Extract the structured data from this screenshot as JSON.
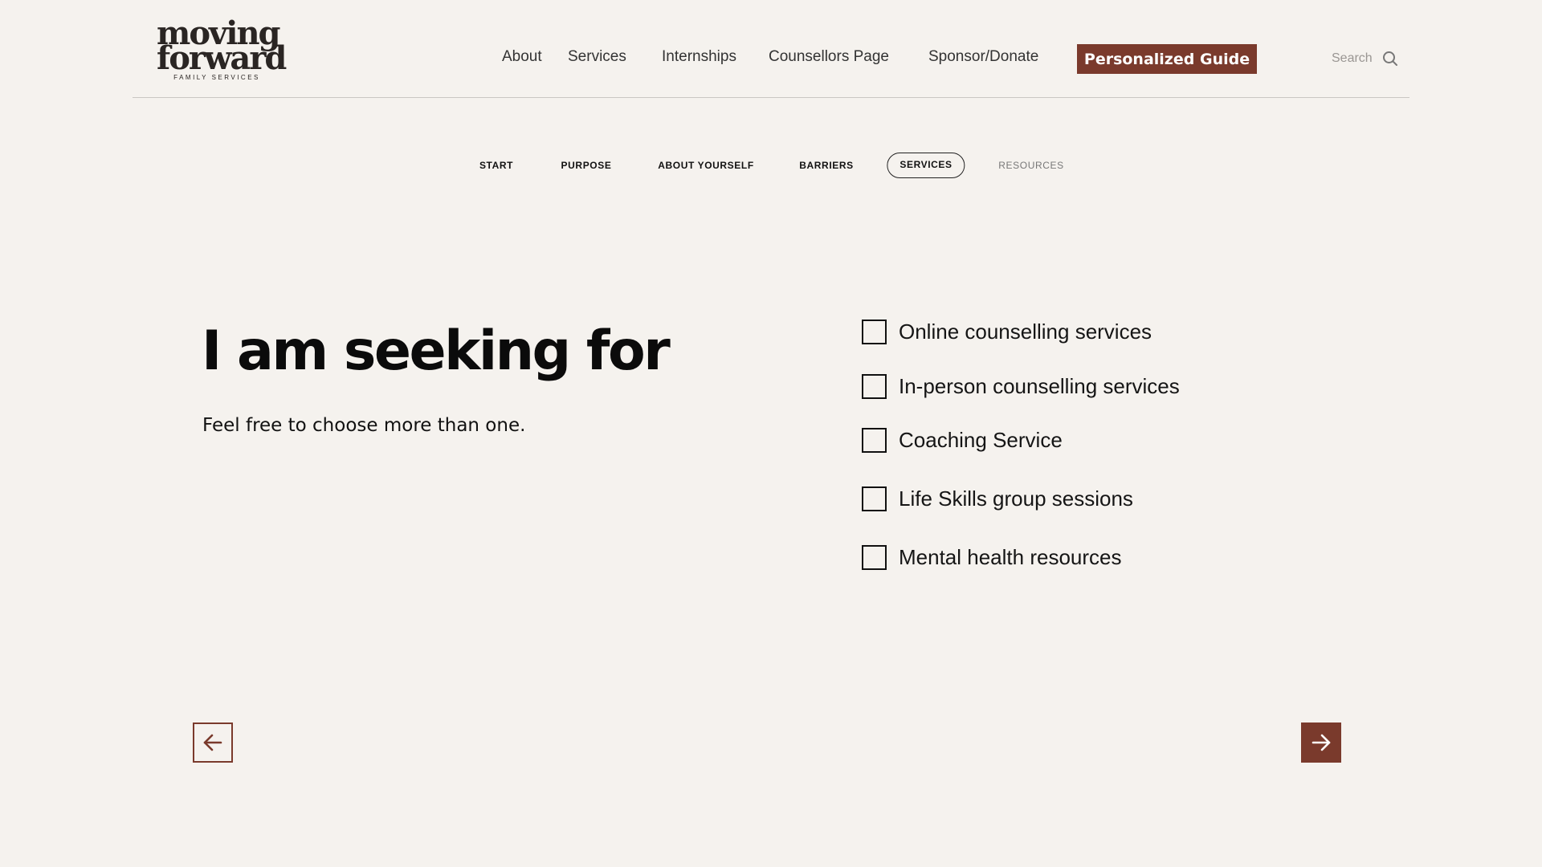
{
  "header": {
    "logo": {
      "line1": "moving",
      "line2": "forward",
      "subtitle": "FAMILY SERVICES"
    },
    "nav": {
      "about": "About",
      "services": "Services",
      "internships": "Internships",
      "counsellors": "Counsellors Page",
      "sponsor": "Sponsor/Donate"
    },
    "guide_button": "Personalized Guide",
    "search_label": "Search",
    "search_icon": "search-icon"
  },
  "steps": {
    "items": [
      {
        "label": "START",
        "state": "done"
      },
      {
        "label": "PURPOSE",
        "state": "done"
      },
      {
        "label": "ABOUT YOURSELF",
        "state": "done"
      },
      {
        "label": "BARRIERS",
        "state": "done"
      },
      {
        "label": "SERVICES",
        "state": "active"
      },
      {
        "label": "RESOURCES",
        "state": "upcoming"
      }
    ]
  },
  "main": {
    "heading": "I am seeking for",
    "subheading": "Feel free to choose more than one.",
    "options": [
      {
        "label": "Online counselling services",
        "checked": false
      },
      {
        "label": "In-person counselling services",
        "checked": false
      },
      {
        "label": "Coaching Service",
        "checked": false
      },
      {
        "label": "Life Skills group sessions",
        "checked": false
      },
      {
        "label": "Mental health resources",
        "checked": false
      }
    ]
  },
  "navigation": {
    "prev_icon": "arrow-left-icon",
    "next_icon": "arrow-right-icon"
  },
  "colors": {
    "background": "#f5f2ee",
    "accent": "#7a3a2c",
    "text": "#111111"
  }
}
